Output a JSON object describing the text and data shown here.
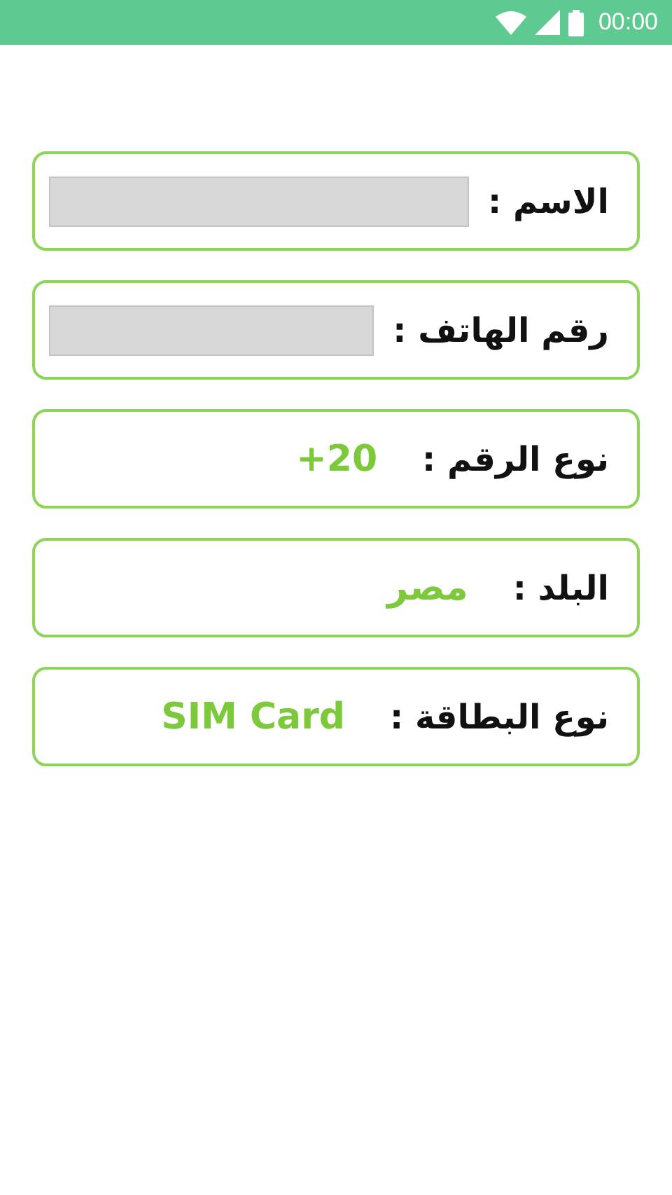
{
  "status_bar": {
    "time": "00:00"
  },
  "rows": [
    {
      "kind": "input",
      "label": "الاسم :"
    },
    {
      "kind": "input",
      "label": "رقم الهاتف :"
    },
    {
      "kind": "value",
      "label": "نوع الرقم :",
      "value": "+20"
    },
    {
      "kind": "value",
      "label": "البلد :",
      "value": "مصر"
    },
    {
      "kind": "value",
      "label": "نوع البطاقة :",
      "value": "SIM Card"
    }
  ]
}
